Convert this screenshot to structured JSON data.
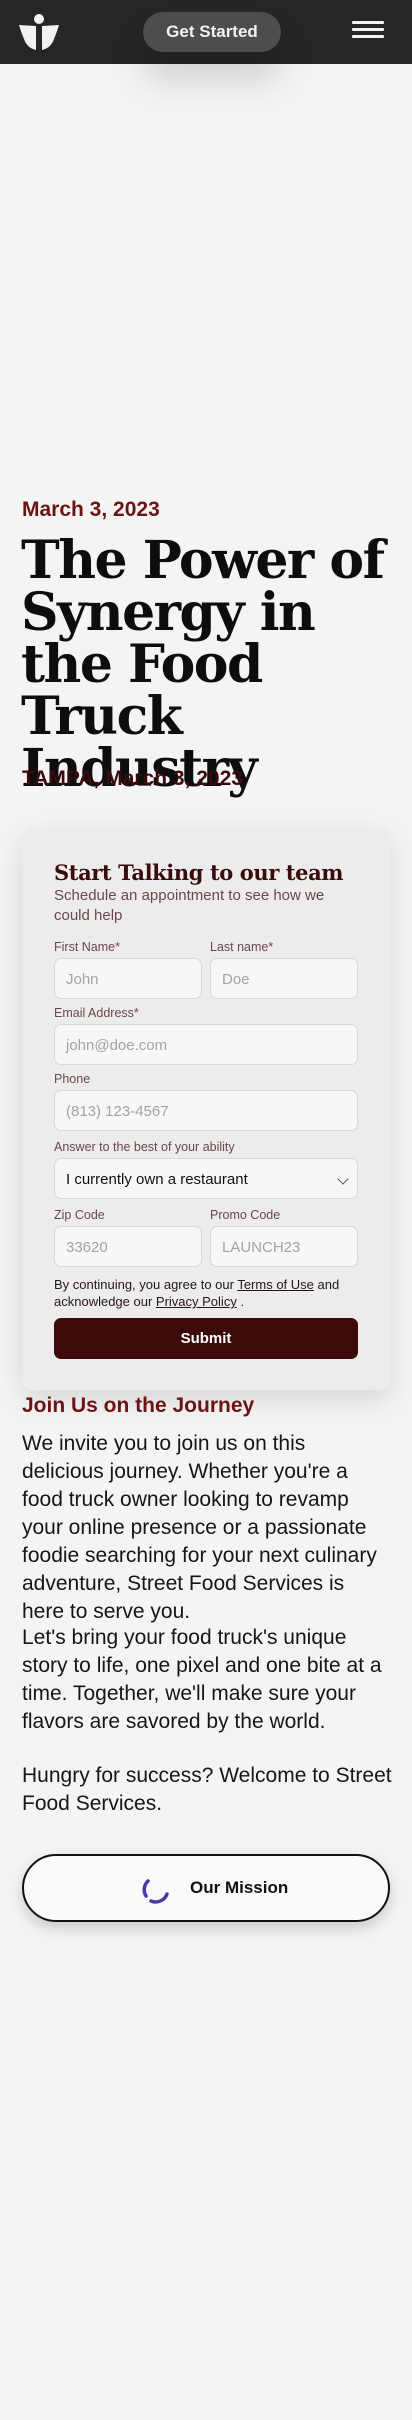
{
  "header": {
    "cta_label": "Get Started",
    "logo_icon": "street-food-logo-icon",
    "menu_icon": "hamburger-menu-icon"
  },
  "article": {
    "date": "March 3, 2023",
    "title": "The Power of Synergy in the Food Truck Industry",
    "dateline": "TAMPA, March 3, 2023"
  },
  "form": {
    "title": "Start Talking to our team",
    "subtitle": "Schedule an appointment to see how we could help",
    "first_name_label": "First Name*",
    "first_name_placeholder": "John",
    "last_name_label": "Last name*",
    "last_name_placeholder": "Doe",
    "email_label": "Email Address*",
    "email_placeholder": "john@doe.com",
    "phone_label": "Phone",
    "phone_placeholder": "(813) 123-4567",
    "answer_label": "Answer to the best of your ability",
    "answer_value": "I currently own a restaurant",
    "zip_label": "Zip Code",
    "zip_placeholder": "33620",
    "promo_label": "Promo Code",
    "promo_placeholder": "LAUNCH23",
    "consent_prefix": "By continuing, you agree to our ",
    "terms_link": "Terms of Use",
    "consent_middle": " and acknowledge our ",
    "privacy_link": "Privacy Policy",
    "consent_suffix": " .",
    "submit_label": "Submit"
  },
  "journey": {
    "heading": "Join Us on the Journey",
    "paragraph_1": "We invite you to join us on this delicious journey. Whether you're a food truck owner looking to revamp your online presence or a passionate foodie searching for your next culinary adventure, Street Food Services is here to serve you.",
    "paragraph_2": "Let's bring your food truck's unique story to life, one pixel and one bite at a time. Together, we'll make sure your flavors are savored by the world.",
    "paragraph_3": "Hungry for success? Welcome to Street Food Services."
  },
  "mission_button": {
    "label": "Our Mission",
    "icon": "loading-spinner-icon"
  },
  "colors": {
    "header_bg": "#262626",
    "accent": "#6b1416",
    "submit_bg": "#3d0a0c",
    "page_bg": "#f4f4f4",
    "spinner": "#4b3aa6"
  }
}
